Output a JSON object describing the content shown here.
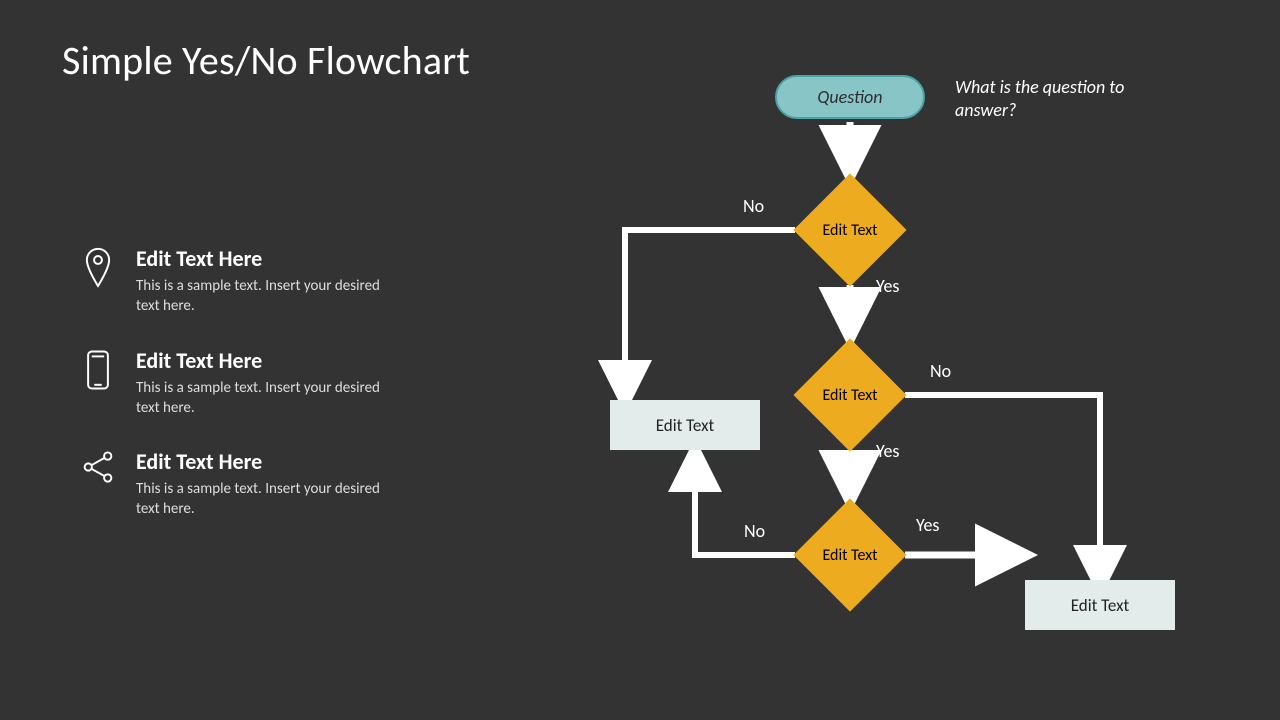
{
  "title": "Simple Yes/No Flowchart",
  "bullets": [
    {
      "title": "Edit Text Here",
      "desc": "This is a sample text. Insert your desired text here."
    },
    {
      "title": "Edit Text Here",
      "desc": "This is a sample text. Insert your desired text here."
    },
    {
      "title": "Edit Text Here",
      "desc": "This is a sample text. Insert your desired text here."
    }
  ],
  "flow": {
    "start_label": "Question",
    "start_hint": "What is the question to answer?",
    "d1": {
      "text": "Edit Text",
      "no": "No",
      "yes": "Yes"
    },
    "d2": {
      "text": "Edit Text",
      "no": "No",
      "yes": "Yes"
    },
    "d3": {
      "text": "Edit Text",
      "no": "No",
      "yes": "Yes"
    },
    "out1": "Edit Text",
    "out2": "Edit Text"
  }
}
